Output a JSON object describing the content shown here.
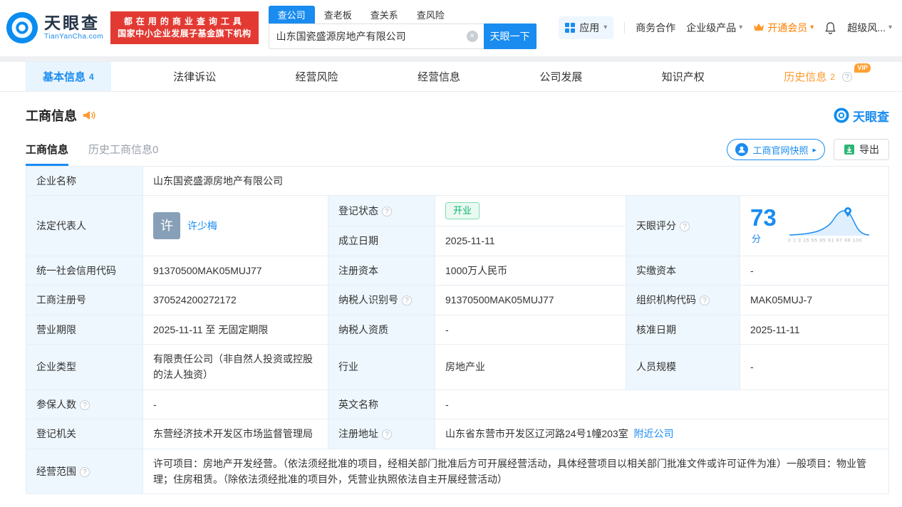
{
  "icons": {
    "question": "?",
    "caret_down": "▾",
    "clear": "×",
    "arrow_right": "▸"
  },
  "brand": {
    "logo_title": "天眼查",
    "logo_subtitle": "TianYanCha.com",
    "banner_line1": "都在用的商业查询工具",
    "banner_line2": "国家中小企业发展子基金旗下机构",
    "watermark": "天眼查"
  },
  "search": {
    "tabs": [
      {
        "label": "查公司"
      },
      {
        "label": "查老板"
      },
      {
        "label": "查关系"
      },
      {
        "label": "查风险"
      }
    ],
    "value": "山东国瓷盛源房地产有限公司",
    "button": "天眼一下"
  },
  "top_nav": {
    "apps": "应用",
    "cooperation": "商务合作",
    "enterprise_products": "企业级产品",
    "vip": "开通会员",
    "super_risk": "超级风..."
  },
  "tabs": [
    {
      "label": "基本信息",
      "count": "4"
    },
    {
      "label": "法律诉讼",
      "count": ""
    },
    {
      "label": "经营风险",
      "count": ""
    },
    {
      "label": "经营信息",
      "count": ""
    },
    {
      "label": "公司发展",
      "count": ""
    },
    {
      "label": "知识产权",
      "count": ""
    },
    {
      "label": "历史信息",
      "count": "2",
      "vip_tag": "VIP"
    }
  ],
  "section": {
    "title": "工商信息",
    "subtab_active": "工商信息",
    "subtab_history": "历史工商信息0",
    "snapshot_button": "工商官网快照",
    "export_button": "导出"
  },
  "table": {
    "company_name_label": "企业名称",
    "company_name": "山东国瓷盛源房地产有限公司",
    "legal_rep_label": "法定代表人",
    "legal_rep_avatar": "许",
    "legal_rep_name": "许少梅",
    "reg_status_label": "登记状态",
    "reg_status": "开业",
    "score_label": "天眼评分",
    "established_label": "成立日期",
    "established": "2025-11-11",
    "credit_code_label": "统一社会信用代码",
    "credit_code": "91370500MAK05MUJ77",
    "reg_capital_label": "注册资本",
    "reg_capital": "1000万人民币",
    "paid_capital_label": "实缴资本",
    "paid_capital": "-",
    "reg_number_label": "工商注册号",
    "reg_number": "370524200272172",
    "taxpayer_id_label": "纳税人识别号",
    "taxpayer_id": "91370500MAK05MUJ77",
    "org_code_label": "组织机构代码",
    "org_code": "MAK05MUJ-7",
    "business_term_label": "营业期限",
    "business_term": "2025-11-11 至 无固定期限",
    "taxpayer_qual_label": "纳税人资质",
    "taxpayer_qual": "-",
    "approval_date_label": "核准日期",
    "approval_date": "2025-11-11",
    "company_type_label": "企业类型",
    "company_type": "有限责任公司（非自然人投资或控股的法人独资）",
    "industry_label": "行业",
    "industry": "房地产业",
    "staff_size_label": "人员规模",
    "staff_size": "-",
    "insured_label": "参保人数",
    "insured": "-",
    "english_name_label": "英文名称",
    "english_name": "-",
    "reg_authority_label": "登记机关",
    "reg_authority": "东营经济技术开发区市场监督管理局",
    "address_label": "注册地址",
    "address": "山东省东营市开发区辽河路24号1幢203室",
    "address_link": "附近公司",
    "business_scope_label": "经营范围",
    "business_scope": "许可项目：房地产开发经营。（依法须经批准的项目，经相关部门批准后方可开展经营活动，具体经营项目以相关部门批准文件或许可证件为准）一般项目：物业管理；住房租赁。（除依法须经批准的项目外，凭营业执照依法自主开展经营活动）"
  },
  "score_chart": {
    "type": "line",
    "score": "73",
    "unit": "分",
    "axis_text": "0 1 3 15 55 85 91 97 99 100"
  }
}
